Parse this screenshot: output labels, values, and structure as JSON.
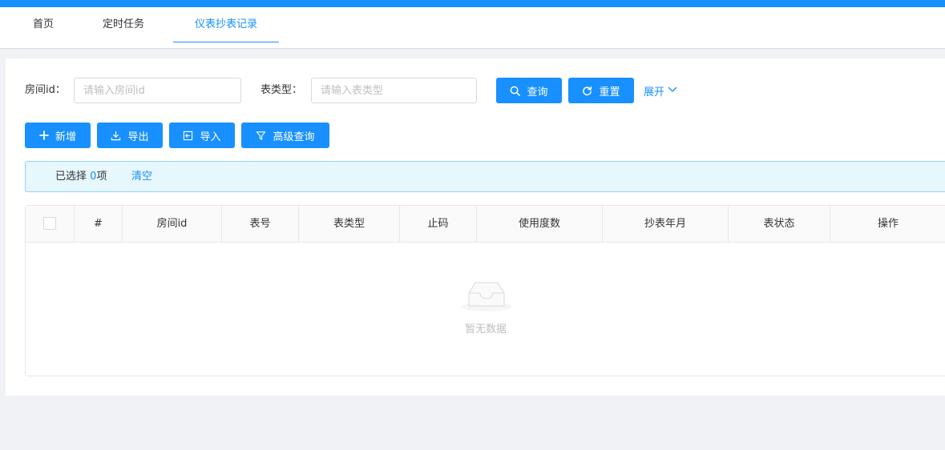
{
  "tabs": [
    {
      "label": "首页"
    },
    {
      "label": "定时任务"
    },
    {
      "label": "仪表抄表记录"
    }
  ],
  "search": {
    "room_label": "房间id：",
    "room_placeholder": "请输入房间id",
    "type_label": "表类型：",
    "type_placeholder": "请输入表类型",
    "query_label": "查询",
    "reset_label": "重置",
    "expand_label": "展开"
  },
  "toolbar": {
    "add_label": "新增",
    "export_label": "导出",
    "import_label": "导入",
    "advanced_label": "高级查询"
  },
  "selection": {
    "prefix": "已选择",
    "count": "0",
    "suffix": "项",
    "clear_label": "清空"
  },
  "table": {
    "columns": [
      "#",
      "房间id",
      "表号",
      "表类型",
      "止码",
      "使用度数",
      "抄表年月",
      "表状态",
      "操作"
    ],
    "empty_text": "暂无数据"
  },
  "colors": {
    "primary": "#1890ff",
    "background": "#f0f2f5"
  }
}
